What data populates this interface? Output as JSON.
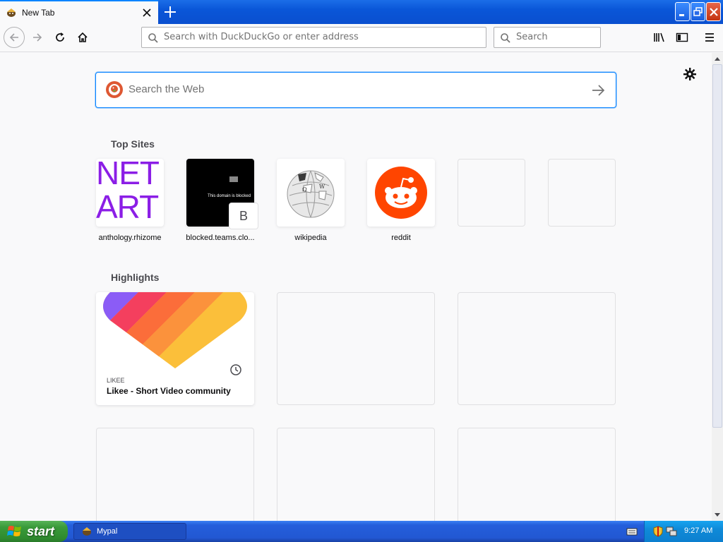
{
  "browser": {
    "tab": {
      "title": "New Tab"
    },
    "urlbar": {
      "placeholder": "Search with DuckDuckGo or enter address"
    },
    "searchbar": {
      "placeholder": "Search"
    }
  },
  "newtab": {
    "search": {
      "placeholder": "Search the Web"
    },
    "top_sites_title": "Top Sites",
    "top_sites": [
      {
        "label": "anthology.rhizome",
        "tile_text_1": "NET",
        "tile_text_2": "ART"
      },
      {
        "label": "blocked.teams.clo...",
        "tile_letter": "B",
        "tile_text": "This domain is blocked"
      },
      {
        "label": "wikipedia"
      },
      {
        "label": "reddit"
      }
    ],
    "highlights_title": "Highlights",
    "highlights": [
      {
        "source": "LIKEE",
        "title": "Likee - Short Video community"
      }
    ]
  },
  "taskbar": {
    "start_label": "start",
    "task_label": "Mypal",
    "time": "9:27 AM"
  },
  "colors": {
    "accent": "#0a84ff",
    "netart": "#8b1ee6",
    "reddit": "#ff4500"
  }
}
